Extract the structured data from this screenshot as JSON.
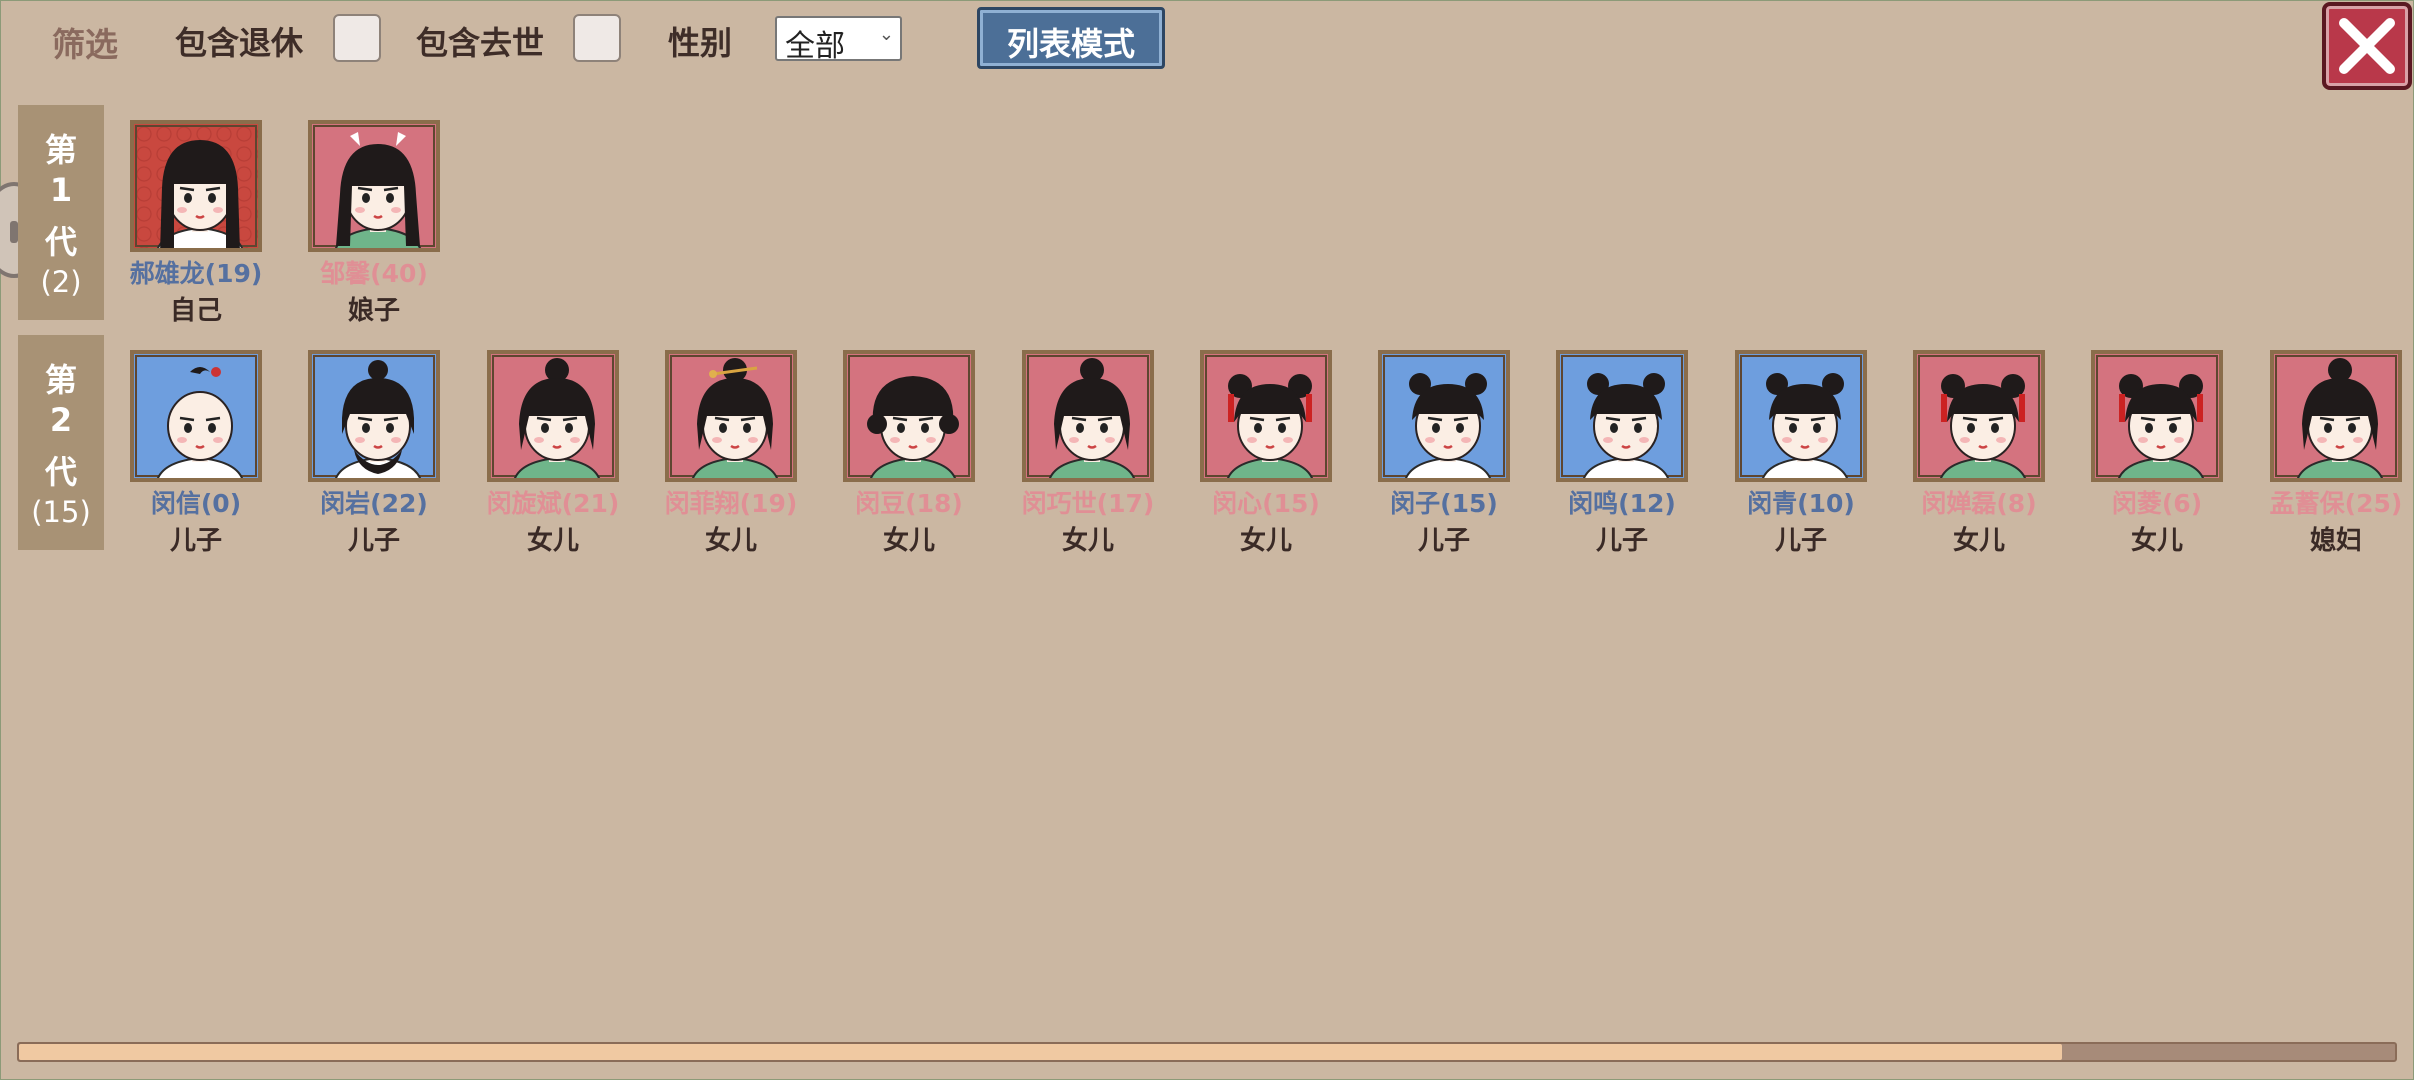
{
  "filter": {
    "title": "筛选",
    "include_retired_label": "包含退休",
    "include_deceased_label": "包含去世",
    "gender_label": "性别",
    "gender_selected": "全部",
    "mode_button": "列表模式"
  },
  "generations": [
    {
      "char1": "第",
      "char2": "1",
      "char3": "代",
      "count": "(2)",
      "members": [
        {
          "name": "郝雄龙(19)",
          "relation": "自己",
          "gender": "male",
          "bg": "pattern",
          "hair": "long"
        },
        {
          "name": "邹馨(40)",
          "relation": "娘子",
          "gender": "female",
          "bg": "red",
          "hair": "bow"
        }
      ]
    },
    {
      "char1": "第",
      "char2": "2",
      "char3": "代",
      "count": "(15)",
      "members": [
        {
          "name": "闵信(0)",
          "relation": "儿子",
          "gender": "male",
          "bg": "blue",
          "hair": "baby"
        },
        {
          "name": "闵岩(22)",
          "relation": "儿子",
          "gender": "male",
          "bg": "blue",
          "hair": "bun-beard"
        },
        {
          "name": "闵旋斌(21)",
          "relation": "女儿",
          "gender": "female",
          "bg": "red",
          "hair": "bun"
        },
        {
          "name": "闵菲翔(19)",
          "relation": "女儿",
          "gender": "female",
          "bg": "red",
          "hair": "bun-pin"
        },
        {
          "name": "闵豆(18)",
          "relation": "女儿",
          "gender": "female",
          "bg": "red",
          "hair": "curly"
        },
        {
          "name": "闵巧世(17)",
          "relation": "女儿",
          "gender": "female",
          "bg": "red",
          "hair": "bun"
        },
        {
          "name": "闵心(15)",
          "relation": "女儿",
          "gender": "female",
          "bg": "red",
          "hair": "twin-ribbon"
        },
        {
          "name": "闵子(15)",
          "relation": "儿子",
          "gender": "male",
          "bg": "blue",
          "hair": "twin-bun"
        },
        {
          "name": "闵鸣(12)",
          "relation": "儿子",
          "gender": "male",
          "bg": "blue",
          "hair": "twin-bun"
        },
        {
          "name": "闵青(10)",
          "relation": "儿子",
          "gender": "male",
          "bg": "blue",
          "hair": "twin-bun"
        },
        {
          "name": "闵婵磊(8)",
          "relation": "女儿",
          "gender": "female",
          "bg": "red",
          "hair": "twin-ribbon"
        },
        {
          "name": "闵菱(6)",
          "relation": "女儿",
          "gender": "female",
          "bg": "red",
          "hair": "twin-ribbon"
        },
        {
          "name": "孟蓄保(25)",
          "relation": "媳妇",
          "gender": "female",
          "bg": "red",
          "hair": "bun"
        }
      ]
    }
  ],
  "scroll": {
    "position": 0.86
  },
  "colors": {
    "background": "#cbb7a2",
    "male_name": "#5570a0",
    "female_name": "#e08f95",
    "close_button": "#b9384a",
    "mode_button": "#4c6f97"
  }
}
